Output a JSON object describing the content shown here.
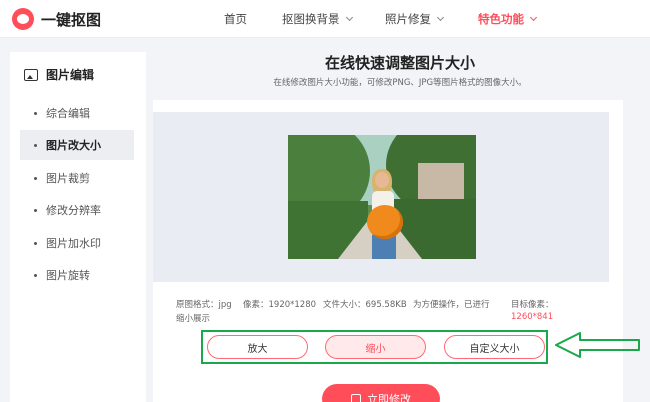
{
  "header": {
    "logo_text": "一键抠图",
    "nav": [
      {
        "label": "首页"
      },
      {
        "label": "抠图换背景"
      },
      {
        "label": "照片修复"
      },
      {
        "label": "特色功能"
      }
    ]
  },
  "sidebar": {
    "title": "图片编辑",
    "items": [
      {
        "label": "综合编辑"
      },
      {
        "label": "图片改大小"
      },
      {
        "label": "图片裁剪"
      },
      {
        "label": "修改分辨率"
      },
      {
        "label": "图片加水印"
      },
      {
        "label": "图片旋转"
      }
    ],
    "active_index": 1
  },
  "main": {
    "title": "在线快速调整图片大小",
    "subtitle": "在线修改图片大小功能，可修改PNG、JPG等图片格式的图像大小。"
  },
  "info": {
    "format": "原图格式：jpg",
    "pixels": "像素：1920*1280",
    "filesize": "文件大小：695.58KB",
    "note_line1": "为方便操作，已进行",
    "note_line2": "缩小展示",
    "target_label": "目标像素：",
    "target_value": "1260*841"
  },
  "options": [
    {
      "label": "放大"
    },
    {
      "label": "缩小"
    },
    {
      "label": "自定义大小"
    }
  ],
  "selected_option_index": 1,
  "submit_label": "立即修改",
  "colors": {
    "accent": "#ff4d5a",
    "annotation": "#19a84a"
  }
}
